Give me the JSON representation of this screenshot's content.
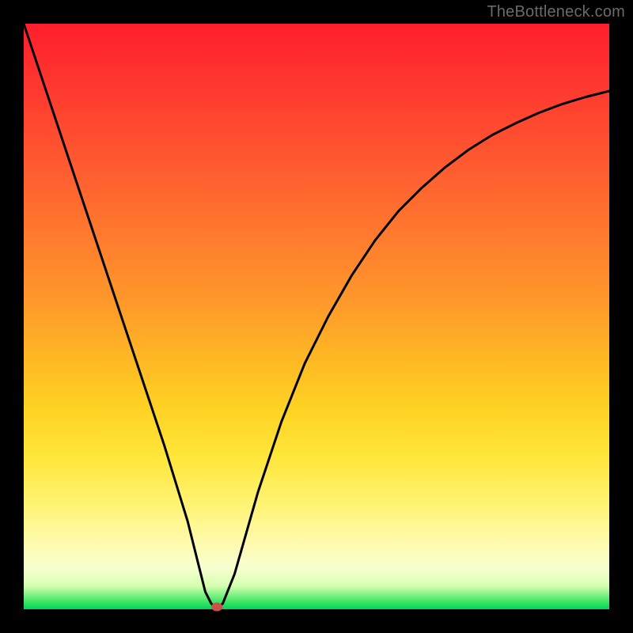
{
  "watermark": "TheBottleneck.com",
  "chart_data": {
    "type": "line",
    "title": "",
    "xlabel": "",
    "ylabel": "",
    "xlim": [
      0,
      100
    ],
    "ylim": [
      0,
      100
    ],
    "grid": false,
    "legend": false,
    "marker": {
      "x": 33,
      "y": 0,
      "color": "#c9524b",
      "radius": 6
    },
    "series": [
      {
        "name": "bottleneck-curve",
        "x": [
          0,
          4,
          8,
          12,
          16,
          20,
          24,
          28,
          30,
          31,
          32,
          33,
          34,
          36,
          38,
          40,
          44,
          48,
          52,
          56,
          60,
          64,
          68,
          72,
          76,
          80,
          84,
          88,
          92,
          96,
          100
        ],
        "y": [
          100,
          88,
          76,
          64,
          52,
          40,
          28,
          15,
          7,
          3,
          1,
          0,
          1,
          6,
          13,
          20,
          32,
          42,
          50,
          57,
          63,
          68,
          72,
          75.5,
          78.5,
          81,
          83,
          84.8,
          86.3,
          87.5,
          88.5
        ]
      }
    ],
    "annotations": []
  }
}
